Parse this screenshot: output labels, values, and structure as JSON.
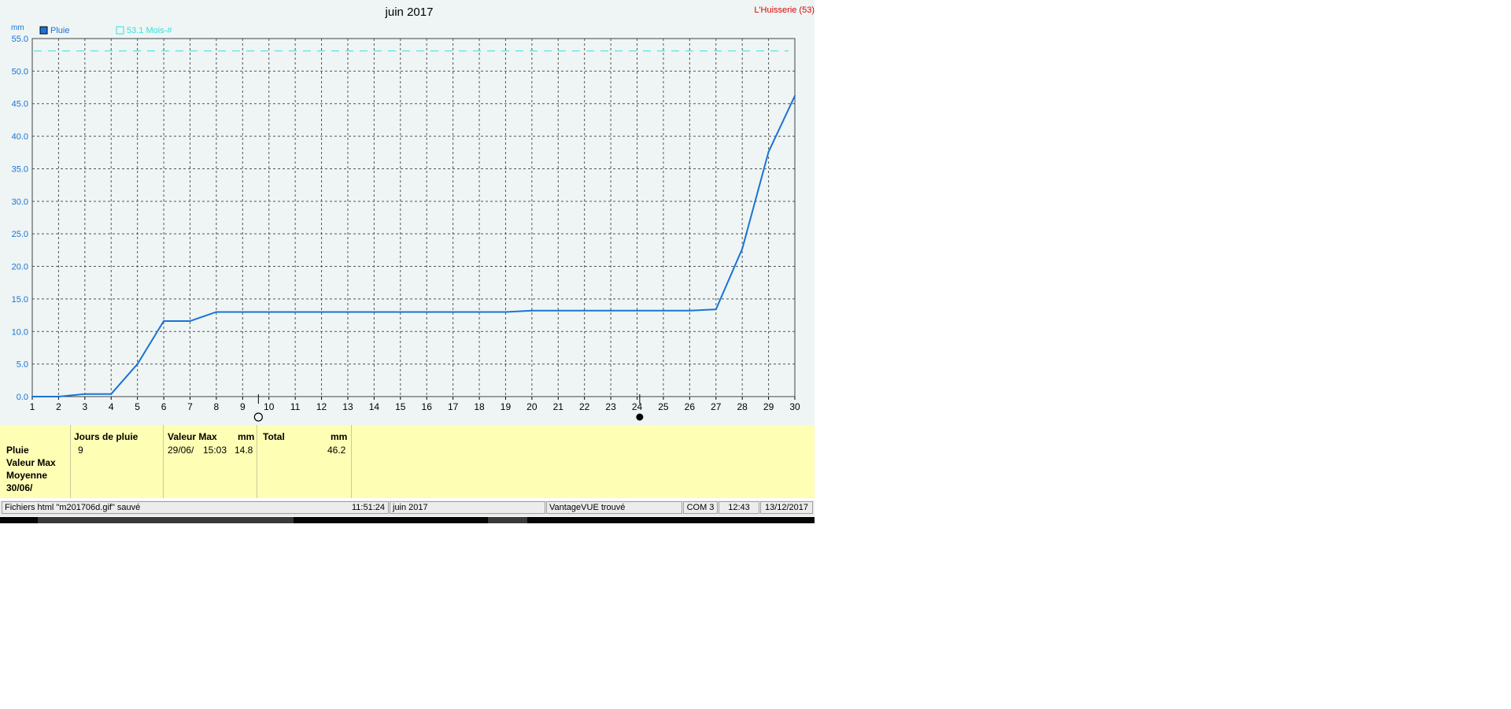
{
  "chart_title": "juin 2017",
  "station": "L'Huisserie (53)",
  "legend": {
    "rain_label": "Pluie",
    "month_avg_label": "53.1 Mois-#"
  },
  "colors": {
    "rain": "#1a73d6",
    "average": "#36e0e0",
    "station": "#e00000",
    "axis_text": "#1a73d6",
    "grid": "#555555",
    "stats_background": "#fefeb4"
  },
  "chart_data": {
    "type": "line",
    "ylabel": "mm",
    "ylim": [
      0,
      55
    ],
    "xlim": [
      1,
      30
    ],
    "yticks": [
      "0.0",
      "5.0",
      "10.0",
      "15.0",
      "20.0",
      "25.0",
      "30.0",
      "35.0",
      "40.0",
      "45.0",
      "50.0",
      "55.0"
    ],
    "xticks": [
      "1",
      "2",
      "3",
      "4",
      "5",
      "6",
      "7",
      "8",
      "9",
      "10",
      "11",
      "12",
      "13",
      "14",
      "15",
      "16",
      "17",
      "18",
      "19",
      "20",
      "21",
      "22",
      "23",
      "24",
      "25",
      "26",
      "27",
      "28",
      "29",
      "30"
    ],
    "grid": true,
    "series": [
      {
        "name": "Pluie",
        "x": [
          1,
          2,
          3,
          4,
          5,
          6,
          7,
          8,
          9,
          10,
          11,
          12,
          13,
          14,
          15,
          16,
          17,
          18,
          19,
          20,
          21,
          22,
          23,
          24,
          25,
          26,
          27,
          28,
          29,
          30
        ],
        "values": [
          0,
          0,
          0.4,
          0.4,
          5.0,
          11.6,
          11.6,
          13.0,
          13.0,
          13.0,
          13.0,
          13.0,
          13.0,
          13.0,
          13.0,
          13.0,
          13.0,
          13.0,
          13.0,
          13.2,
          13.2,
          13.2,
          13.2,
          13.2,
          13.2,
          13.2,
          13.4,
          22.7,
          37.6,
          46.2
        ]
      }
    ],
    "reference_line": {
      "label": "53.1 Mois-#",
      "value": 53.1
    },
    "moon_phases": [
      {
        "x": 9.6,
        "phase": "new-moon"
      },
      {
        "x": 24.1,
        "phase": "full-moon"
      }
    ]
  },
  "stats": {
    "row_labels": [
      "Pluie",
      "Valeur Max",
      "Moyenne",
      "30/06/"
    ],
    "col1": {
      "header": "Jours de pluie",
      "value": "9"
    },
    "col2": {
      "header": "Valeur Max",
      "unit": "mm",
      "date": "29/06/",
      "time": "15:03",
      "value": "14.8"
    },
    "col3": {
      "header": "Total",
      "unit": "mm",
      "value": "46.2"
    }
  },
  "status_bar": {
    "message": "Fichiers html  \"m201706d.gif\"  sauvé",
    "time": "11:51:24",
    "period": "juin 2017",
    "device": "VantageVUE trouvé",
    "port": "COM 3",
    "clock": "12:43",
    "date": "13/12/2017"
  }
}
